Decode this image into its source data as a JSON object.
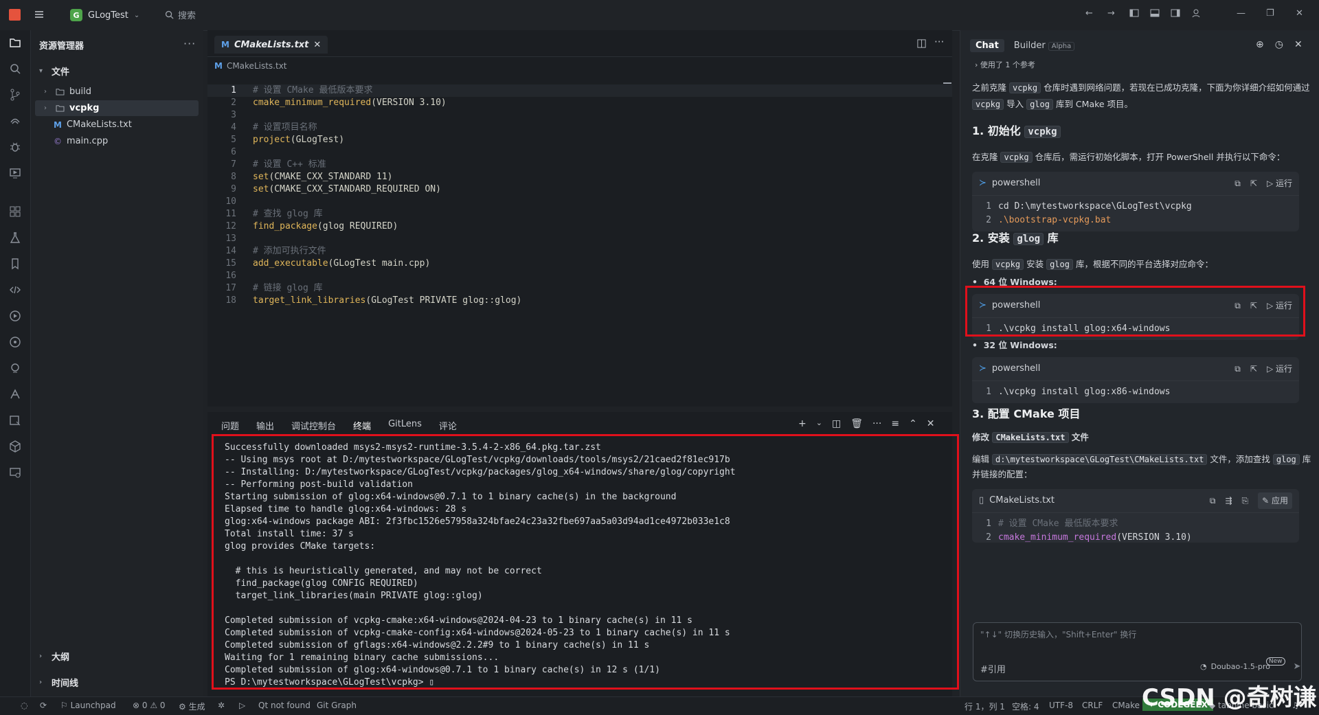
{
  "titlebar": {
    "project_badge": "G",
    "project_name": "GLogTest",
    "search_label": "搜索"
  },
  "explorer": {
    "title": "资源管理器",
    "more": "···",
    "files_section": "文件",
    "items": [
      {
        "label": "build"
      },
      {
        "label": "vcpkg"
      },
      {
        "label": "CMakeLists.txt"
      },
      {
        "label": "main.cpp"
      }
    ],
    "outline_section": "大纲",
    "timeline_section": "时间线"
  },
  "editor": {
    "tab_label": "CMakeLists.txt",
    "tab_icon_text": "M",
    "breadcrumb": "CMakeLists.txt",
    "lines": [
      {
        "n": "1",
        "text": "# 设置 CMake 最低版本要求"
      },
      {
        "n": "2",
        "fn": "cmake_minimum_required",
        "rest": "(VERSION 3.10)"
      },
      {
        "n": "3",
        "text": ""
      },
      {
        "n": "4",
        "text": "# 设置项目名称"
      },
      {
        "n": "5",
        "fn": "project",
        "rest": "(GLogTest)"
      },
      {
        "n": "6",
        "text": ""
      },
      {
        "n": "7",
        "text": "# 设置 C++ 标准"
      },
      {
        "n": "8",
        "fn": "set",
        "rest": "(CMAKE_CXX_STANDARD 11)"
      },
      {
        "n": "9",
        "fn": "set",
        "rest": "(CMAKE_CXX_STANDARD_REQUIRED ON)"
      },
      {
        "n": "10",
        "text": ""
      },
      {
        "n": "11",
        "text": "# 查找 glog 库"
      },
      {
        "n": "12",
        "fn": "find_package",
        "rest": "(glog REQUIRED)"
      },
      {
        "n": "13",
        "text": ""
      },
      {
        "n": "14",
        "text": "# 添加可执行文件"
      },
      {
        "n": "15",
        "fn": "add_executable",
        "rest": "(GLogTest main.cpp)"
      },
      {
        "n": "16",
        "text": ""
      },
      {
        "n": "17",
        "text": "# 链接 glog 库"
      },
      {
        "n": "18",
        "fn": "target_link_libraries",
        "rest": "(GLogTest PRIVATE glog::glog)"
      }
    ]
  },
  "panel": {
    "tabs": [
      "问题",
      "输出",
      "调试控制台",
      "终端",
      "GitLens",
      "评论"
    ],
    "active_tab": "终端",
    "terminal_lines": [
      "Successfully downloaded msys2-msys2-runtime-3.5.4-2-x86_64.pkg.tar.zst",
      "-- Using msys root at D:/mytestworkspace/GLogTest/vcpkg/downloads/tools/msys2/21caed2f81ec917b",
      "-- Installing: D:/mytestworkspace/GLogTest/vcpkg/packages/glog_x64-windows/share/glog/copyright",
      "-- Performing post-build validation",
      "Starting submission of glog:x64-windows@0.7.1 to 1 binary cache(s) in the background",
      "Elapsed time to handle glog:x64-windows: 28 s",
      "glog:x64-windows package ABI: 2f3fbc1526e57958a324bfae24c23a32fbe697aa5a03d94ad1ce4972b033e1c8",
      "Total install time: 37 s",
      "glog provides CMake targets:",
      "",
      "  # this is heuristically generated, and may not be correct",
      "  find_package(glog CONFIG REQUIRED)",
      "  target_link_libraries(main PRIVATE glog::glog)",
      "",
      "Completed submission of vcpkg-cmake:x64-windows@2024-04-23 to 1 binary cache(s) in 11 s",
      "Completed submission of vcpkg-cmake-config:x64-windows@2024-05-23 to 1 binary cache(s) in 11 s",
      "Completed submission of gflags:x64-windows@2.2.2#9 to 1 binary cache(s) in 11 s",
      "Waiting for 1 remaining binary cache submissions...",
      "Completed submission of glog:x64-windows@0.7.1 to 1 binary cache(s) in 12 s (1/1)",
      "PS D:\\mytestworkspace\\GLogTest\\vcpkg> "
    ]
  },
  "chat": {
    "tab_chat": "Chat",
    "tab_builder": "Builder",
    "alpha_badge": "Alpha",
    "ref_note": "使用了 1 个参考",
    "intro_1": "之前克隆 ",
    "intro_code_1": "vcpkg",
    "intro_2": " 仓库时遇到网络问题，若现在已成功克隆，下面为你详细介绍如何通过 ",
    "intro_code_2": "vcpkg",
    "intro_3": " 导入 ",
    "intro_code_3": "glog",
    "intro_4": " 库到 CMake 项目。",
    "h1_text": "1. 初始化 ",
    "h1_code": "vcpkg",
    "p1_a": "在克隆 ",
    "p1_code": "vcpkg",
    "p1_b": " 仓库后，需运行初始化脚本，打开 PowerShell 并执行以下命令：",
    "block_lang": "powershell",
    "run_label": "运行",
    "apply_label": "应用",
    "block1_lines": [
      {
        "n": "1",
        "text": "cd D:\\mytestworkspace\\GLogTest\\vcpkg"
      },
      {
        "n": "2",
        "text": ".\\bootstrap-vcpkg.bat"
      }
    ],
    "h2_text": "2. 安装 ",
    "h2_code": "glog",
    "h2_tail": " 库",
    "p2_a": "使用 ",
    "p2_code1": "vcpkg",
    "p2_b": " 安装 ",
    "p2_code2": "glog",
    "p2_c": " 库，根据不同的平台选择对应命令：",
    "bullet_64": "64 位 Windows:",
    "block2_line": {
      "n": "1",
      "text": ".\\vcpkg install glog:x64-windows"
    },
    "bullet_32": "32 位 Windows:",
    "block3_line": {
      "n": "1",
      "text": ".\\vcpkg install glog:x86-windows"
    },
    "h3_text": "3. 配置 CMake 项目",
    "p3_a": "修改 ",
    "p3_code": "CMakeLists.txt",
    "p3_b": " 文件",
    "p4_a": "编辑 ",
    "p4_code": "d:\\mytestworkspace\\GLogTest\\CMakeLists.txt",
    "p4_b": " 文件，添加查找 ",
    "p4_code2": "glog",
    "p4_c": " 库并链接的配置：",
    "block4_title": "CMakeLists.txt",
    "block4_lines": [
      {
        "n": "1",
        "text": "# 设置 CMake 最低版本要求"
      },
      {
        "n": "2",
        "fn": "cmake_minimum_required",
        "rest": "(VERSION 3.10)"
      }
    ],
    "input_placeholder": "\"↑↓\" 切换历史输入，\"Shift+Enter\" 换行",
    "cite_label": "#引用",
    "model_label": "Doubao-1.5-pro",
    "new_badge": "New"
  },
  "status": {
    "launchpad": "Launchpad",
    "errors": "0",
    "warnings": "0",
    "build": "生成",
    "qt": "Qt not found",
    "git_graph": "Git Graph",
    "position": "行 1，列 1",
    "spaces": "空格: 4",
    "encoding": "UTF-8",
    "eol": "CRLF",
    "lang": "CMake",
    "codegeex": "CODEGEEX",
    "tabnine": "tabnine basic"
  },
  "watermark": "CSDN @奇树谦",
  "colors": {
    "accent_red": "#e0101b",
    "codegeex_green": "#2f7a3a",
    "badge_green": "#4ea44a"
  }
}
